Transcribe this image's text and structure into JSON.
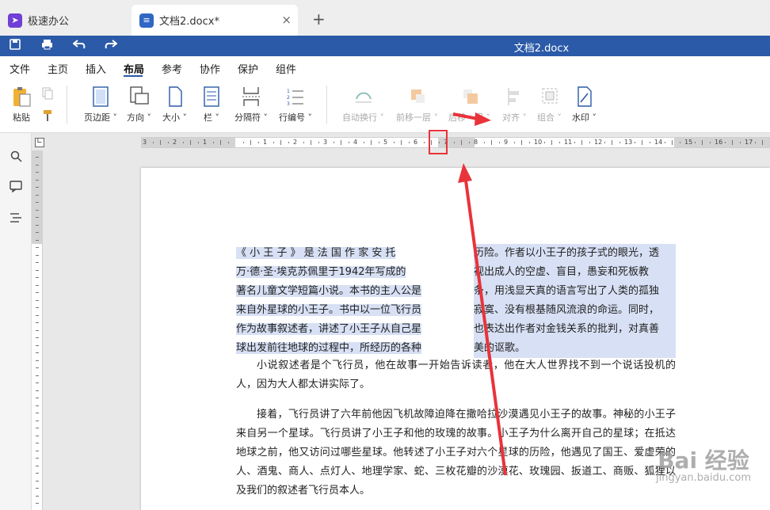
{
  "tabs": {
    "app_tab": {
      "label": "极速办公"
    },
    "doc_tab": {
      "label": "文档2.docx*",
      "close": "×"
    },
    "add": "+"
  },
  "titlebar": {
    "title": "文档2.docx"
  },
  "menu": {
    "items": [
      "文件",
      "主页",
      "插入",
      "布局",
      "参考",
      "协作",
      "保护",
      "组件"
    ],
    "active": "布局"
  },
  "ribbon": {
    "paste": "粘贴",
    "margins": "页边距",
    "orientation": "方向",
    "size": "大小",
    "columns": "栏",
    "breaks": "分隔符",
    "line_numbers": "行编号",
    "wrap": "自动换行",
    "bring_forward": "前移一层",
    "send_backward": "后移一层",
    "align": "对齐",
    "group": "组合",
    "watermark": "水印"
  },
  "ruler": {
    "top_labels": [
      "3",
      "2",
      "1",
      "1",
      "2",
      "3",
      "4",
      "5",
      "6",
      "7",
      "8",
      "9",
      "10",
      "11",
      "12",
      "13",
      "14",
      "15",
      "16",
      "17"
    ]
  },
  "document": {
    "left_column": [
      "《 小 王 子 》 是 法 国 作 家 安 托",
      "万·德·圣·埃克苏佩里于1942年写成的",
      "著名儿童文学短篇小说。本书的主人公是",
      "来自外星球的小王子。书中以一位飞行员",
      "作为故事叙述者，讲述了小王子从自己星",
      "球出发前往地球的过程中，所经历的各种"
    ],
    "right_column": [
      "历险。作者以小王子的孩子式的眼光，透",
      "视出成人的空虚、盲目，愚妄和死板教",
      "条，用浅显天真的语言写出了人类的孤独",
      "寂寞、没有根基随风流浪的命运。同时，",
      "也表达出作者对金钱关系的批判，对真善",
      "美的讴歌。"
    ],
    "para2": "小说叙述者是个飞行员，他在故事一开始告诉读者，他在大人世界找不到一个说话投机的人，因为大人都太讲实际了。",
    "para3": "接着，飞行员讲了六年前他因飞机故障迫降在撒哈拉沙漠遇见小王子的故事。神秘的小王子来自另一个星球。飞行员讲了小王子和他的玫瑰的故事。小王子为什么离开自己的星球；在抵达地球之前，他又访问过哪些星球。他转述了小王子对六个星球的历险，他遇见了国王、爱虚荣的人、酒鬼、商人、点灯人、地理学家、蛇、三枚花瓣的沙漠花、玫瑰园、扳道工、商贩、狐狸以及我们的叙述者飞行员本人。"
  },
  "watermark": {
    "line1": "Bai 经验",
    "line2": "jingyan.baidu.com"
  },
  "colors": {
    "accent": "#2b5aa8",
    "selection": "#d7e0f4",
    "annotation": "#e8333a"
  }
}
